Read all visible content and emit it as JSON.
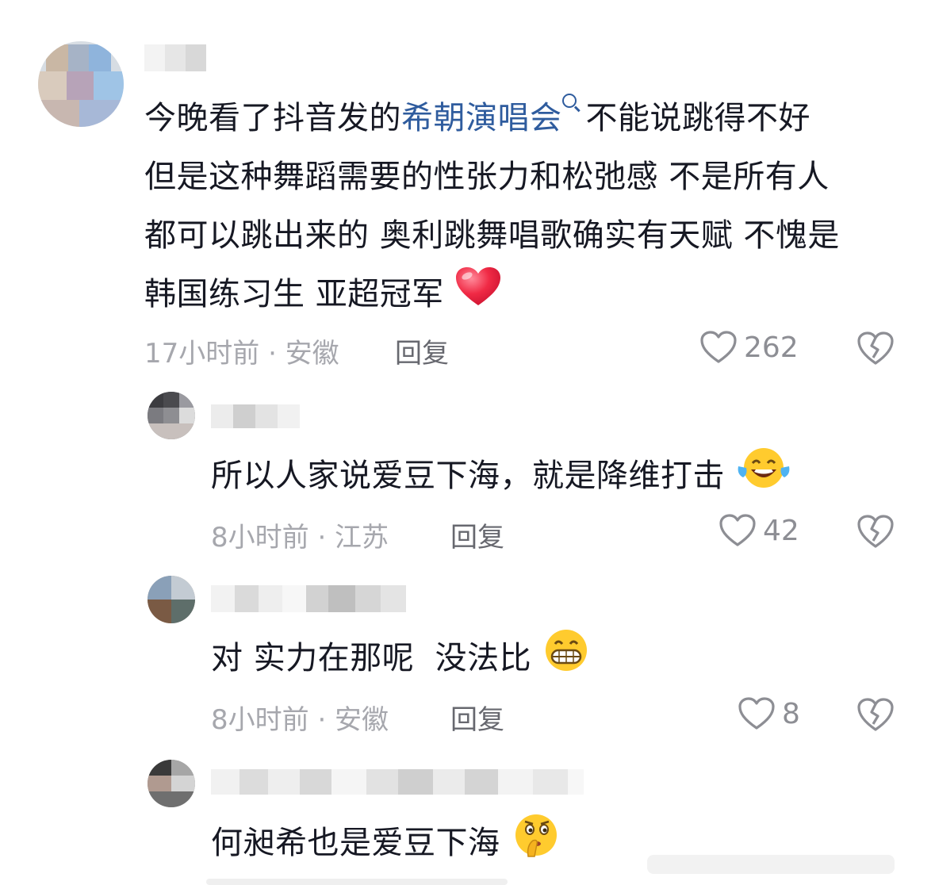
{
  "comments": [
    {
      "text_before": "今晚看了抖音发的",
      "hashtag": "希朝演唱会",
      "text_after": "不能说跳得不好",
      "line2": "但是这种舞蹈需要的性张力和松弛感 不是所有人",
      "line3": "都可以跳出来的 奥利跳舞唱歌确实有天赋 不愧是",
      "line4": "韩国练习生 亚超冠军",
      "meta": "17小时前 · 安徽",
      "reply_label": "回复",
      "likes": "262",
      "emoji": "red-heart"
    },
    {
      "text": "所以人家说爱豆下海，就是降维打击",
      "meta": "8小时前 · 江苏",
      "reply_label": "回复",
      "likes": "42",
      "emoji": "tears-of-joy"
    },
    {
      "text": "对 实力在那呢  没法比",
      "meta": "8小时前 · 安徽",
      "reply_label": "回复",
      "likes": "8",
      "emoji": "grinning-face"
    },
    {
      "text": "何昶希也是爱豆下海",
      "emoji": "shushing-face"
    }
  ],
  "colors": {
    "hashtag": "#2f5c9e",
    "meta": "#a6a7ad",
    "reply": "#67686f",
    "like": "#8d8e94"
  }
}
